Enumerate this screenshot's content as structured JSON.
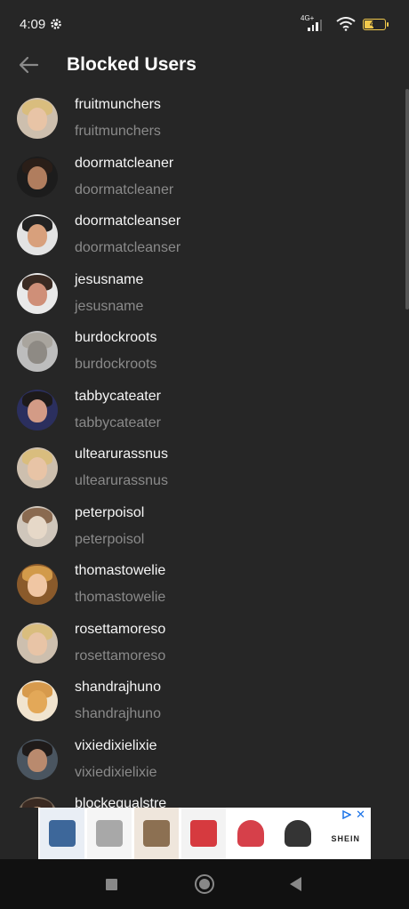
{
  "status": {
    "time": "4:09",
    "network": "4G+",
    "battery": "48",
    "battery_level": 0.48,
    "icons": [
      "gear-icon",
      "signal-icon",
      "wifi-icon",
      "battery-icon"
    ]
  },
  "header": {
    "title": "Blocked Users",
    "back_icon": "arrow-left-icon"
  },
  "users": [
    {
      "name": "fruitmunchers",
      "handle": "fruitmunchers",
      "avatar_bg": "#cdbfae",
      "face": "#e8c4a6",
      "hair": "#d9bd7e"
    },
    {
      "name": "doormatcleaner",
      "handle": "doormatcleaner",
      "avatar_bg": "#1c1c1c",
      "face": "#b07d5e",
      "hair": "#2a1e18"
    },
    {
      "name": "doormatcleanser",
      "handle": "doormatcleanser",
      "avatar_bg": "#e3e3e3",
      "face": "#d8a07c",
      "hair": "#222222"
    },
    {
      "name": "jesusname",
      "handle": "jesusname",
      "avatar_bg": "#e9e9e9",
      "face": "#cf8f78",
      "hair": "#3a2a22"
    },
    {
      "name": "burdockroots",
      "handle": "burdockroots",
      "avatar_bg": "#bdbdbd",
      "face": "#8e8a84",
      "hair": "#a9a59e"
    },
    {
      "name": "tabbycateater",
      "handle": "tabbycateater",
      "avatar_bg": "#2b2f5e",
      "face": "#d39b86",
      "hair": "#1d1a1a"
    },
    {
      "name": "ultearurassnus",
      "handle": "ultearurassnus",
      "avatar_bg": "#cdbfae",
      "face": "#e8c4a6",
      "hair": "#d9bd7e"
    },
    {
      "name": "peterpoisol",
      "handle": "peterpoisol",
      "avatar_bg": "#cfc6bb",
      "face": "#e6d8c8",
      "hair": "#8a6a50"
    },
    {
      "name": "thomastowelie",
      "handle": "thomastowelie",
      "avatar_bg": "#8a5a2b",
      "face": "#f0c6a3",
      "hair": "#d29a4a"
    },
    {
      "name": "rosettamoreso",
      "handle": "rosettamoreso",
      "avatar_bg": "#cdbfae",
      "face": "#e8c4a6",
      "hair": "#d9bd7e"
    },
    {
      "name": "shandrajhuno",
      "handle": "shandrajhuno",
      "avatar_bg": "#f1e4cf",
      "face": "#e3a858",
      "hair": "#d79a4c"
    },
    {
      "name": "vixiedixielixie",
      "handle": "vixiedixielixie",
      "avatar_bg": "#4a5560",
      "face": "#b98a6e",
      "hair": "#1f1b1a"
    },
    {
      "name": "blockequalstre",
      "handle": "",
      "avatar_bg": "#7a6a5a",
      "face": "#c49a7a",
      "hair": "#3a2a22"
    }
  ],
  "ad": {
    "brand": "SHEIN",
    "play_icon": "ad-choices-icon",
    "close_icon": "close-icon",
    "close": "✕",
    "tiles": [
      {
        "icon": "socks-product-icon",
        "bg": "#e9eef5",
        "accent": "#1f4f8a"
      },
      {
        "icon": "hairband-product-icon",
        "bg": "#f5f5f5",
        "accent": "#9a9a9a"
      },
      {
        "icon": "leopard-scarf-product-icon",
        "bg": "#efe6dc",
        "accent": "#7a5a3a"
      },
      {
        "icon": "red-gloves-product-icon",
        "bg": "#f3f3f3",
        "accent": "#d0191f"
      },
      {
        "icon": "red-cap-product-icon",
        "bg": "#ffffff",
        "accent": "#cf1f2a"
      },
      {
        "icon": "black-cap-product-icon",
        "bg": "#ffffff",
        "accent": "#111111"
      }
    ]
  },
  "nav": {
    "recents_icon": "square-recents-icon",
    "home_icon": "circle-home-icon",
    "back_icon": "triangle-back-icon"
  }
}
